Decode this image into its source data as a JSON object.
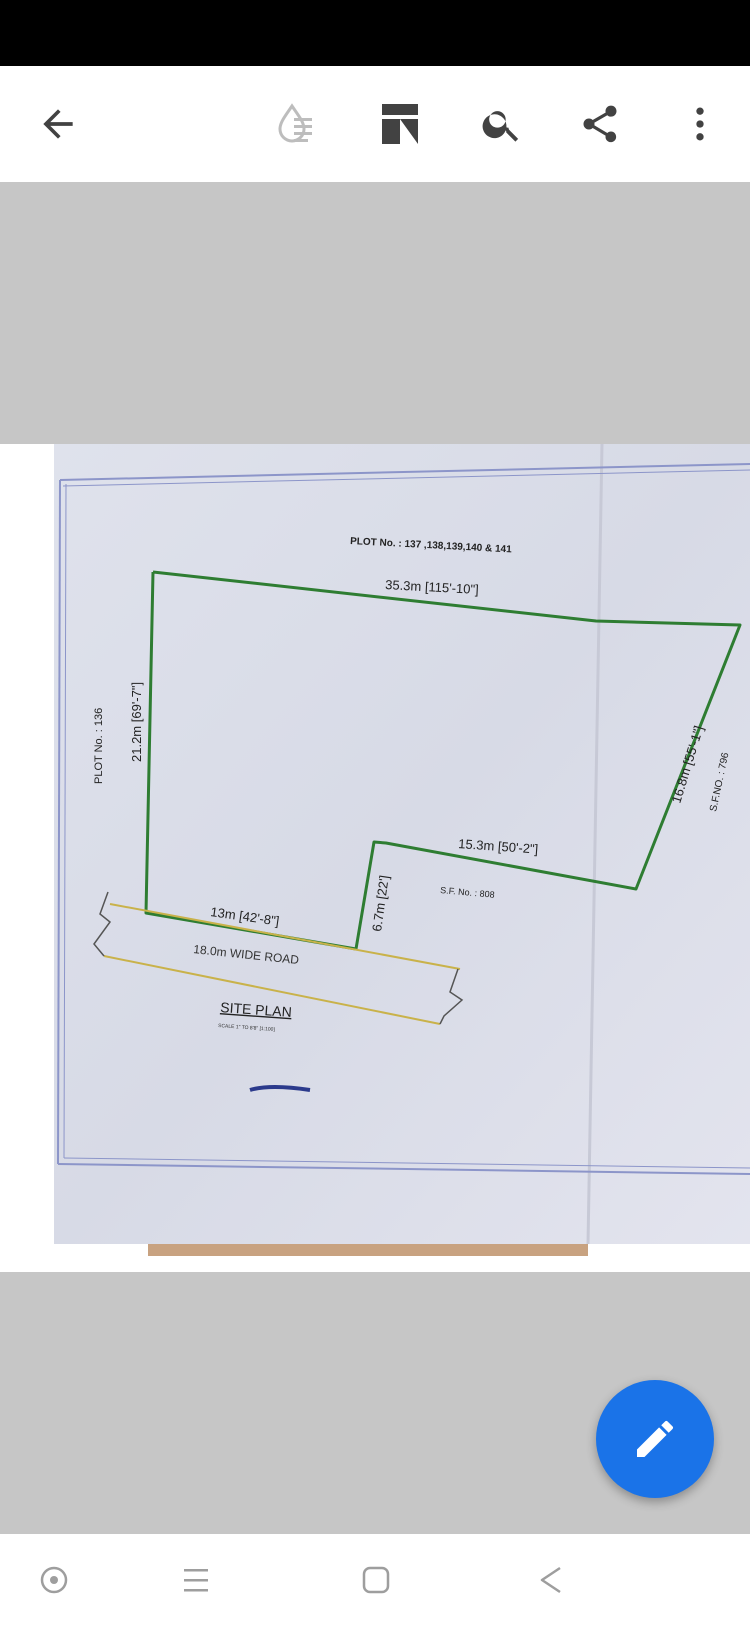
{
  "app_bar": {
    "icons": [
      "back-arrow-icon",
      "ink-drop-icon",
      "page-layout-icon",
      "search-icon",
      "share-icon",
      "more-vert-icon"
    ]
  },
  "document": {
    "plot_top": "PLOT No. : 137 ,138,139,140 & 141",
    "top_dimension": "35.3m [115'-10\"]",
    "left_plot": "PLOT No. : 136",
    "left_dimension": "21.2m [69'-7\"]",
    "right_dimension": "16.8m [55'-1\"]",
    "right_sf": "S.F.NO. : 796",
    "inner_dimension": "15.3m [50'-2\"]",
    "sf_no": "S.F. No. : 808",
    "notch_dimension": "6.7m [22']",
    "bottom_dimension": "13m [42'-8\"]",
    "road_label": "18.0m WIDE ROAD",
    "site_plan": "SITE PLAN",
    "scale": "SCALE 1\" TO 8'8\" [1:100]"
  },
  "fab": {
    "icon": "edit-pencil-icon",
    "color": "#1a73e8"
  },
  "nav_bar": {
    "icons": [
      "assistant-circle-icon",
      "recent-apps-icon",
      "home-square-icon",
      "back-triangle-icon"
    ]
  }
}
